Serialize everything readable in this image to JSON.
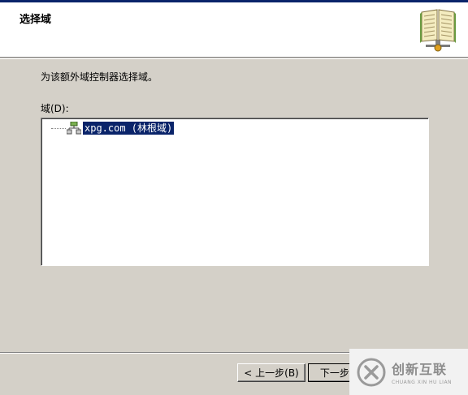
{
  "header": {
    "title": "选择域"
  },
  "content": {
    "description": "为该额外域控制器选择域。",
    "domain_label": "域(D):"
  },
  "tree": {
    "items": [
      {
        "label": "xpg.com (林根域)",
        "selected": true
      }
    ]
  },
  "buttons": {
    "back_label": "< 上一步(B)",
    "next_label": "下一步(N)"
  },
  "watermark": {
    "name": "创新互联",
    "sub": "CHUANG XIN HU LIAN"
  },
  "colors": {
    "dialog_bg": "#d4d0c8",
    "selection": "#0a246a",
    "header_bg": "#ffffff"
  }
}
